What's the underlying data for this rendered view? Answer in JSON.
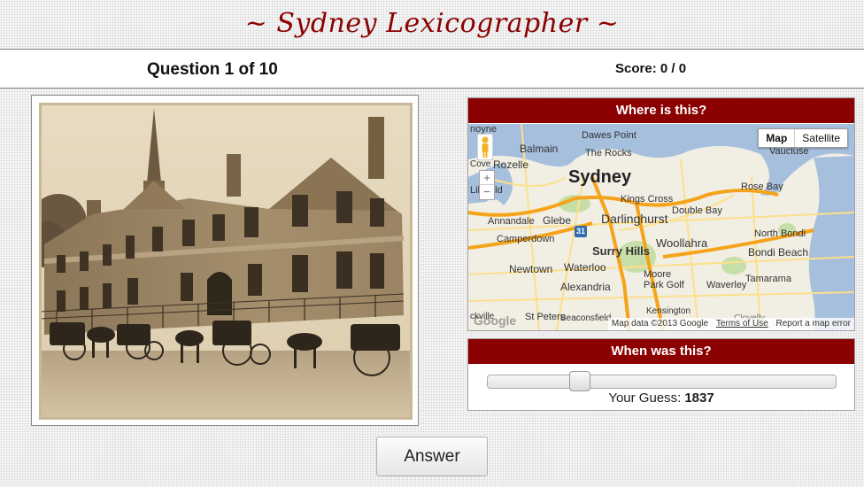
{
  "app": {
    "title": "~ Sydney Lexicographer ~"
  },
  "status": {
    "question": "Question 1 of 10",
    "score": "Score: 0 / 0"
  },
  "location_panel": {
    "header": "Where is this?",
    "map_type": {
      "map_label": "Map",
      "satellite_label": "Satellite",
      "selected": "Map"
    },
    "zoom_in": "+",
    "zoom_out": "−",
    "places": [
      "noyne",
      "Dawes Point",
      "Balmain",
      "The Rocks",
      "Vaucluse",
      "Rozelle",
      "Sydney",
      "Cove",
      "Lilyfield",
      "Kings Cross",
      "Rose Bay",
      "Annandale",
      "Glebe",
      "Darlinghurst",
      "Double Bay",
      "North Bondi",
      "Camperdown",
      "Surry Hills",
      "Woollahra",
      "Bondi Beach",
      "Newtown",
      "Waterloo",
      "Moore Park Golf",
      "Waverley",
      "Tamarama",
      "Alexandria",
      "St Peters",
      "Beaconsfield",
      "Kensington",
      "ckville",
      "Clovelly"
    ],
    "route_shield": "31",
    "google_logo": "Google",
    "footer": {
      "map_data": "Map data ©2013 Google",
      "terms": "Terms of Use",
      "report": "Report a map error"
    }
  },
  "date_panel": {
    "header": "When was this?",
    "slider_position": 0.25,
    "guess_label": "Your Guess:",
    "guess_value": "1837"
  },
  "actions": {
    "answer_label": "Answer"
  },
  "colors": {
    "accent": "#8b0000",
    "water": "#a5bfdd",
    "land": "#f1eee4",
    "road_major": "#f5a31a",
    "road_minor": "#fde08c",
    "park": "#c6dfa9",
    "sepia_light": "#e4d6bb",
    "sepia_dark": "#6e5a41"
  }
}
